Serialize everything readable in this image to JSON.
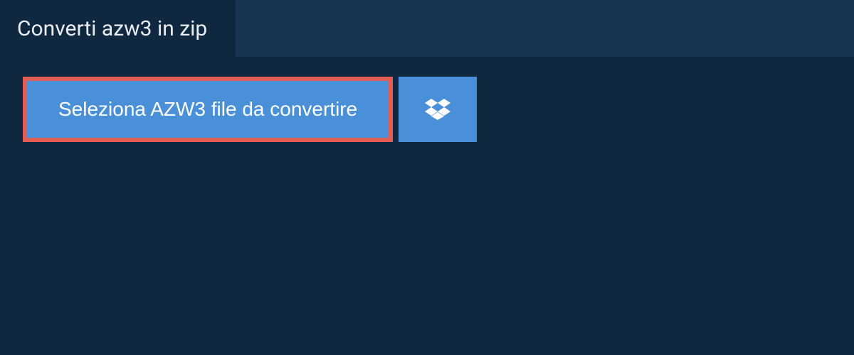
{
  "tab": {
    "title": "Converti azw3 in zip"
  },
  "actions": {
    "select_file_label": "Seleziona AZW3 file da convertire"
  }
}
